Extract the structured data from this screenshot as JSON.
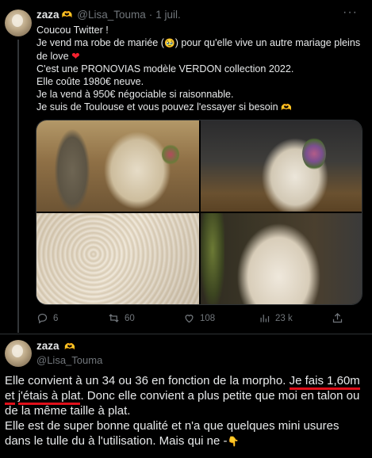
{
  "tweet1": {
    "author_name": "zaza",
    "author_badge": "🫶",
    "handle": "@Lisa_Touma",
    "separator": "·",
    "date": "1 juil.",
    "more_label": "···",
    "lines": [
      "Coucou Twitter !",
      "Je vend ma robe de mariée (🥹) pour qu'elle vive un autre mariage pleins de love ❤️",
      "C'est une PRONOVIAS modèle VERDON collection 2022.",
      "Elle coûte 1980€ neuve.",
      "Je la vend à 950€ négociable si raisonnable.",
      "Je suis de Toulouse et vous pouvez l'essayer si besoin 🫶"
    ],
    "line2_text": "Je vend ma robe de mariée (",
    "line2_emoji": "🥹",
    "line2_tail": ") pour qu'elle vive un autre mariage pleins de love ",
    "line2_heart": "❤",
    "line6_text": "Je suis de Toulouse et vous pouvez l'essayer si besoin ",
    "line6_emoji": "🫶",
    "images": [
      "wedding-couple-photo",
      "dress-bouquet-photo",
      "lace-detail-photo",
      "dress-skirt-photo"
    ],
    "stats": {
      "replies": "6",
      "reposts": "60",
      "likes": "108",
      "views": "23 k"
    }
  },
  "tweet2": {
    "author_name": "zaza",
    "author_badge": "🫶",
    "handle": "@Lisa_Touma",
    "text_part1": "Elle convient à un 34 ou 36 en fonction de la morpho. ",
    "text_underlined1": "Je fais 1,60m et",
    "text_underlined2": "j'étais à plat",
    "text_part2": ". Donc elle convient a plus petite que moi en talon ou de la même taille à plat.",
    "text_line2": "Elle est de super bonne qualité et n'a que quelques mini usures dans le tulle du à l'utilisation. Mais qui ne -",
    "text_end_emoji": "👇"
  },
  "colors": {
    "background": "#000000",
    "text": "#e7e9ea",
    "muted": "#71767b",
    "heart": "#f4212e",
    "annotation_red": "#e0101a",
    "divider": "#2f3336"
  }
}
